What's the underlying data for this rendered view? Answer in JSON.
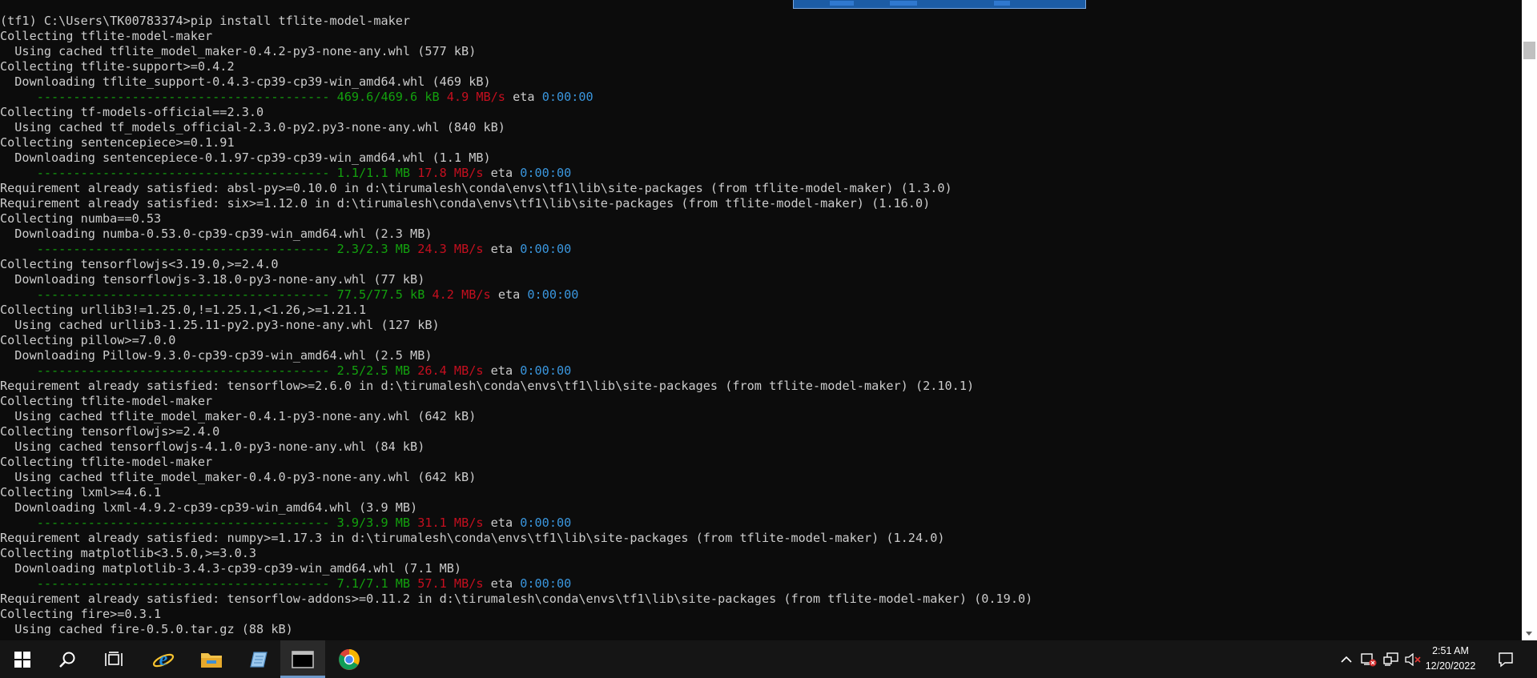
{
  "console": {
    "lines": [
      {
        "text": "(tf1) C:\\Users\\TK00783374>pip install tflite-model-maker"
      },
      {
        "text": "Collecting tflite-model-maker"
      },
      {
        "text": "  Using cached tflite_model_maker-0.4.2-py3-none-any.whl (577 kB)"
      },
      {
        "text": "Collecting tflite-support>=0.4.2"
      },
      {
        "text": "  Downloading tflite_support-0.4.3-cp39-cp39-win_amd64.whl (469 kB)"
      },
      {
        "progress": {
          "bar": "     ---------------------------------------- ",
          "size": "469.6/469.6 kB",
          "speed": "4.9 MB/s",
          "eta_label": "eta",
          "eta": "0:00:00"
        }
      },
      {
        "text": "Collecting tf-models-official==2.3.0"
      },
      {
        "text": "  Using cached tf_models_official-2.3.0-py2.py3-none-any.whl (840 kB)"
      },
      {
        "text": "Collecting sentencepiece>=0.1.91"
      },
      {
        "text": "  Downloading sentencepiece-0.1.97-cp39-cp39-win_amd64.whl (1.1 MB)"
      },
      {
        "progress": {
          "bar": "     ---------------------------------------- ",
          "size": "1.1/1.1 MB",
          "speed": "17.8 MB/s",
          "eta_label": "eta",
          "eta": "0:00:00"
        }
      },
      {
        "text": "Requirement already satisfied: absl-py>=0.10.0 in d:\\tirumalesh\\conda\\envs\\tf1\\lib\\site-packages (from tflite-model-maker) (1.3.0)"
      },
      {
        "text": "Requirement already satisfied: six>=1.12.0 in d:\\tirumalesh\\conda\\envs\\tf1\\lib\\site-packages (from tflite-model-maker) (1.16.0)"
      },
      {
        "text": "Collecting numba==0.53"
      },
      {
        "text": "  Downloading numba-0.53.0-cp39-cp39-win_amd64.whl (2.3 MB)"
      },
      {
        "progress": {
          "bar": "     ---------------------------------------- ",
          "size": "2.3/2.3 MB",
          "speed": "24.3 MB/s",
          "eta_label": "eta",
          "eta": "0:00:00"
        }
      },
      {
        "text": "Collecting tensorflowjs<3.19.0,>=2.4.0"
      },
      {
        "text": "  Downloading tensorflowjs-3.18.0-py3-none-any.whl (77 kB)"
      },
      {
        "progress": {
          "bar": "     ---------------------------------------- ",
          "size": "77.5/77.5 kB",
          "speed": "4.2 MB/s",
          "eta_label": "eta",
          "eta": "0:00:00"
        }
      },
      {
        "text": "Collecting urllib3!=1.25.0,!=1.25.1,<1.26,>=1.21.1"
      },
      {
        "text": "  Using cached urllib3-1.25.11-py2.py3-none-any.whl (127 kB)"
      },
      {
        "text": "Collecting pillow>=7.0.0"
      },
      {
        "text": "  Downloading Pillow-9.3.0-cp39-cp39-win_amd64.whl (2.5 MB)"
      },
      {
        "progress": {
          "bar": "     ---------------------------------------- ",
          "size": "2.5/2.5 MB",
          "speed": "26.4 MB/s",
          "eta_label": "eta",
          "eta": "0:00:00"
        }
      },
      {
        "text": "Requirement already satisfied: tensorflow>=2.6.0 in d:\\tirumalesh\\conda\\envs\\tf1\\lib\\site-packages (from tflite-model-maker) (2.10.1)"
      },
      {
        "text": "Collecting tflite-model-maker"
      },
      {
        "text": "  Using cached tflite_model_maker-0.4.1-py3-none-any.whl (642 kB)"
      },
      {
        "text": "Collecting tensorflowjs>=2.4.0"
      },
      {
        "text": "  Using cached tensorflowjs-4.1.0-py3-none-any.whl (84 kB)"
      },
      {
        "text": "Collecting tflite-model-maker"
      },
      {
        "text": "  Using cached tflite_model_maker-0.4.0-py3-none-any.whl (642 kB)"
      },
      {
        "text": "Collecting lxml>=4.6.1"
      },
      {
        "text": "  Downloading lxml-4.9.2-cp39-cp39-win_amd64.whl (3.9 MB)"
      },
      {
        "progress": {
          "bar": "     ---------------------------------------- ",
          "size": "3.9/3.9 MB",
          "speed": "31.1 MB/s",
          "eta_label": "eta",
          "eta": "0:00:00"
        }
      },
      {
        "text": "Requirement already satisfied: numpy>=1.17.3 in d:\\tirumalesh\\conda\\envs\\tf1\\lib\\site-packages (from tflite-model-maker) (1.24.0)"
      },
      {
        "text": "Collecting matplotlib<3.5.0,>=3.0.3"
      },
      {
        "text": "  Downloading matplotlib-3.4.3-cp39-cp39-win_amd64.whl (7.1 MB)"
      },
      {
        "progress": {
          "bar": "     ---------------------------------------- ",
          "size": "7.1/7.1 MB",
          "speed": "57.1 MB/s",
          "eta_label": "eta",
          "eta": "0:00:00"
        }
      },
      {
        "text": "Requirement already satisfied: tensorflow-addons>=0.11.2 in d:\\tirumalesh\\conda\\envs\\tf1\\lib\\site-packages (from tflite-model-maker) (0.19.0)"
      },
      {
        "text": "Collecting fire>=0.3.1"
      },
      {
        "text": "  Using cached fire-0.5.0.tar.gz (88 kB)"
      }
    ]
  },
  "taskbar": {
    "apps": [
      {
        "name": "start-button",
        "icon": "windows-logo-icon"
      },
      {
        "name": "search-button",
        "icon": "search-icon"
      },
      {
        "name": "task-view-button",
        "icon": "task-view-icon"
      },
      {
        "name": "internet-explorer-button",
        "icon": "internet-explorer-icon"
      },
      {
        "name": "file-explorer-button",
        "icon": "folder-icon"
      },
      {
        "name": "notes-app-button",
        "icon": "notes-icon"
      },
      {
        "name": "command-prompt-button",
        "icon": "terminal-icon",
        "active": true
      },
      {
        "name": "chrome-button",
        "icon": "chrome-icon"
      }
    ],
    "tray": {
      "icons": [
        "chevron-up-icon",
        "network-status-icon",
        "network-icon",
        "volume-muted-icon",
        "notification-icon"
      ],
      "time": "2:51 AM",
      "date": "12/20/2022"
    },
    "colors": {
      "background": "#151515",
      "active_underline": "#6d98c9"
    }
  }
}
